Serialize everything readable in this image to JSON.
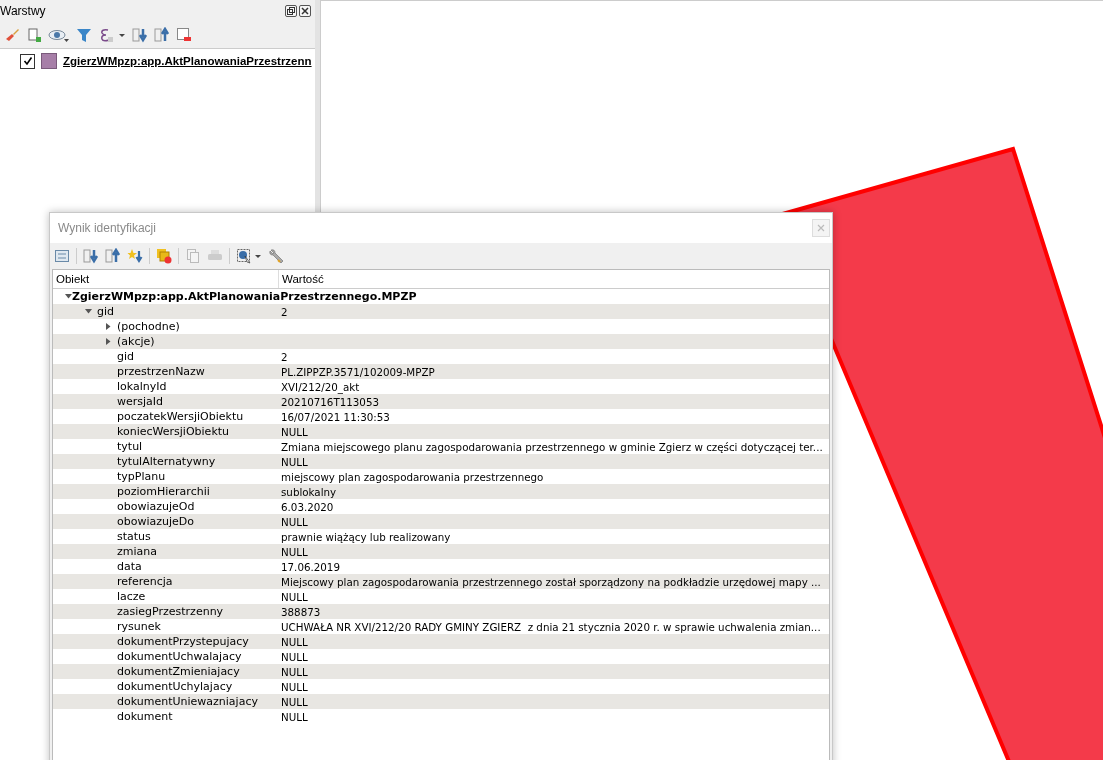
{
  "layers_panel": {
    "title": "Warstwy",
    "layers": [
      {
        "name": "ZgierzWMpzp:app.AktPlanowaniaPrzestrzenn",
        "checked": true
      }
    ]
  },
  "identify_dialog": {
    "title": "Wynik identyfikacji",
    "columns": [
      "Obiekt",
      "Wartość"
    ],
    "tree": [
      {
        "name": "ZgierzWMpzp:app.AktPlanowaniaPrzestrzennego.MPZP",
        "expanded": true,
        "children": [
          {
            "name": "gid",
            "value": "2",
            "expanded": true,
            "children": [
              {
                "name": "(pochodne)",
                "expanded": false
              },
              {
                "name": "(akcje)",
                "expanded": false
              },
              {
                "name": "gid",
                "value": "2"
              },
              {
                "name": "przestrzenNazw",
                "value": "PL.ZIPPZP.3571/102009-MPZP"
              },
              {
                "name": "lokalnyId",
                "value": "XVI/212/20_akt"
              },
              {
                "name": "wersjaId",
                "value": "20210716T113053"
              },
              {
                "name": "poczatekWersjiObiektu",
                "value": "16/07/2021 11:30:53"
              },
              {
                "name": "koniecWersjiObiektu",
                "value": "NULL"
              },
              {
                "name": "tytul",
                "value": "Zmiana miejscowego planu zagospodarowania przestrzennego w gminie Zgierz w części dotyczącej ter..."
              },
              {
                "name": "tytulAlternatywny",
                "value": "NULL"
              },
              {
                "name": "typPlanu",
                "value": "miejscowy plan zagospodarowania przestrzennego"
              },
              {
                "name": "poziomHierarchii",
                "value": "sublokalny"
              },
              {
                "name": "obowiazujeOd",
                "value": "6.03.2020"
              },
              {
                "name": "obowiazujeDo",
                "value": "NULL"
              },
              {
                "name": "status",
                "value": "prawnie wiążący lub realizowany"
              },
              {
                "name": "zmiana",
                "value": "NULL"
              },
              {
                "name": "data",
                "value": "17.06.2019"
              },
              {
                "name": "referencja",
                "value": "Miejscowy plan zagospodarowania przestrzennego został sporządzony na podkładzie urzędowej mapy ..."
              },
              {
                "name": "lacze",
                "value": "NULL"
              },
              {
                "name": "zasiegPrzestrzenny",
                "value": "388873"
              },
              {
                "name": "rysunek",
                "value": "UCHWAŁA NR XVI/212/20 RADY GMINY ZGIERZ  z dnia 21 stycznia 2020 r. w sprawie uchwalenia zmian..."
              },
              {
                "name": "dokumentPrzystepujacy",
                "value": "NULL"
              },
              {
                "name": "dokumentUchwalajacy",
                "value": "NULL"
              },
              {
                "name": "dokumentZmieniajacy",
                "value": "NULL"
              },
              {
                "name": "dokumentUchylajacy",
                "value": "NULL"
              },
              {
                "name": "dokumentUniewazniajacy",
                "value": "NULL"
              },
              {
                "name": "dokument",
                "value": "NULL"
              }
            ]
          }
        ]
      }
    ]
  }
}
